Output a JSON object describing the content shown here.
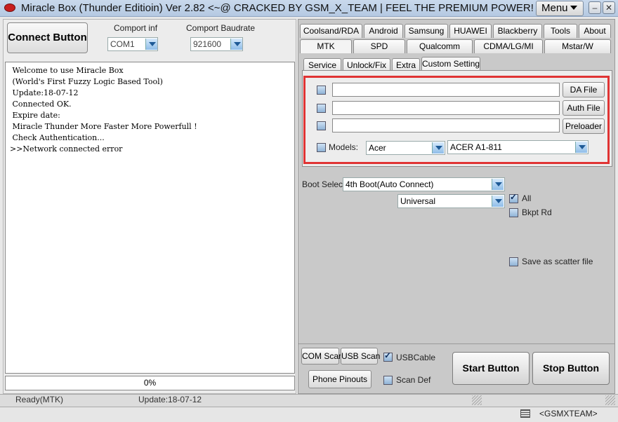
{
  "window": {
    "title": "Miracle Box (Thunder Editioin) Ver 2.82 <~@ CRACKED BY GSM_X_TEAM | FEEL THE PREMIUM POWER! @~>",
    "menu_label": "Menu",
    "minimize": "–",
    "close": "✕"
  },
  "left": {
    "connect_label": "Connect Button",
    "comport_label": "Comport inf",
    "comport_value": "COM1",
    "baud_label": "Comport Baudrate",
    "baud_value": "921600",
    "log_lines": [
      " Welcome to use Miracle Box",
      " (World's First Fuzzy Logic Based Tool)",
      " Update:18-07-12",
      " Connected OK.",
      " Expire date:",
      " Miracle Thunder More Faster More Powerfull !",
      " Check Authentication...",
      ">>Network connected error"
    ],
    "progress_text": "0%",
    "progress_value": 0
  },
  "tabs_row1": [
    "Coolsand/RDA",
    "Android",
    "Samsung",
    "HUAWEI",
    "Blackberry",
    "Tools",
    "About"
  ],
  "tabs_row2": [
    "MTK",
    "SPD",
    "Qualcomm",
    "CDMA/LG/MI",
    "Mstar/W"
  ],
  "subtabs": [
    "Service",
    "Unlock/Fix",
    "Extra",
    "Custom Setting"
  ],
  "custom_setting": {
    "da_button": "DA File",
    "auth_button": "Auth File",
    "preloader_button": "Preloader",
    "models_label": "Models:",
    "brand_value": "Acer",
    "model_value": "ACER A1-811"
  },
  "mtk": {
    "boot_label": "Boot Select:",
    "boot_value": "4th Boot(Auto Connect)",
    "mode_value": "Universal",
    "all_label": "All",
    "bkpt_label": "Bkpt Rd",
    "scatter_label": "Save as scatter file"
  },
  "bottom": {
    "com_scan": "COM Scan",
    "usb_scan": "USB Scan",
    "usbcable_label": "USBCable",
    "phone_pinouts": "Phone Pinouts",
    "scan_def_label": "Scan Def",
    "start_button": "Start Button",
    "stop_button": "Stop Button"
  },
  "status": {
    "left": "Ready(MTK)",
    "update": "Update:18-07-12",
    "team": "<GSMXTEAM>"
  },
  "colors": {
    "highlight": "#e03434",
    "combo_arrow": "#1e5a96"
  }
}
